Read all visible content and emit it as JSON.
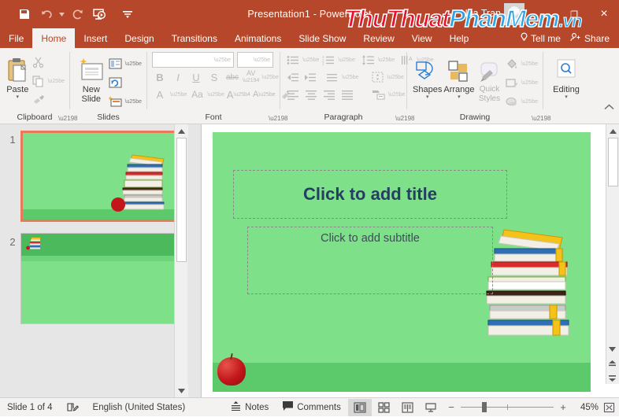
{
  "window": {
    "title": "Presentation1  -  PowerPoint",
    "user": "Nga Tran",
    "minimize": "–",
    "restore": "❐",
    "close": "×",
    "ribbon_display_icon": "ribbon-display-options-icon",
    "quick_access": [
      {
        "name": "save-icon",
        "label": "Save"
      },
      {
        "name": "undo-icon",
        "label": "Undo"
      },
      {
        "name": "redo-icon",
        "label": "Redo"
      },
      {
        "name": "start-presentation-icon",
        "label": "Start From Beginning"
      },
      {
        "name": "customize-quick-access-toolbar-icon",
        "label": "Customize Quick Access Toolbar"
      }
    ]
  },
  "watermark": {
    "part1": "ThuThuat",
    "part2": "PhanMem",
    "part3": ".vn"
  },
  "tabs": [
    {
      "label": "File",
      "active": false
    },
    {
      "label": "Home",
      "active": true
    },
    {
      "label": "Insert",
      "active": false
    },
    {
      "label": "Design",
      "active": false
    },
    {
      "label": "Transitions",
      "active": false
    },
    {
      "label": "Animations",
      "active": false
    },
    {
      "label": "Slide Show",
      "active": false
    },
    {
      "label": "Review",
      "active": false
    },
    {
      "label": "View",
      "active": false
    },
    {
      "label": "Help",
      "active": false
    }
  ],
  "tellme": {
    "label": "Tell me",
    "icon": "lightbulb-icon"
  },
  "share": {
    "label": "Share",
    "icon": "share-person-icon"
  },
  "ribbon": {
    "collapse_icon": "chevron-up-icon",
    "groups": [
      {
        "name": "clipboard",
        "label": "Clipboard",
        "paste": {
          "label": "Paste",
          "caret": "▾"
        },
        "cut": "cut-scissors-icon",
        "copy": "copy-icon",
        "format_painter": "format-painter-icon"
      },
      {
        "name": "slides",
        "label": "Slides",
        "new_slide": {
          "label": "New Slide",
          "caret": "▾"
        },
        "layout": "slide-layout-icon",
        "reset": "reset-slide-icon",
        "section": "section-icon"
      },
      {
        "name": "font",
        "label": "Font",
        "font_name_value": "",
        "font_size_value": "",
        "bold": "B",
        "italic": "I",
        "underline": "U",
        "shadow": "S",
        "strikethrough": "abc",
        "character_spacing": "AV",
        "font_color": "A",
        "change_case": "Aa",
        "increase_font": "A",
        "decrease_font": "A",
        "clear_formatting": "clear-formatting-icon"
      },
      {
        "name": "paragraph",
        "label": "Paragraph",
        "bullets": "bullets-icon",
        "numbering": "numbering-icon",
        "line_spacing": "line-spacing-icon",
        "text_direction": "text-direction-icon",
        "decrease_indent": "decrease-indent-icon",
        "increase_indent": "increase-indent-icon",
        "columns": "columns-icon",
        "align_text": "align-text-vertical-icon",
        "align_left": "align-left-icon",
        "align_center": "align-center-icon",
        "align_right": "align-right-icon",
        "justify": "justify-icon",
        "smartart": "convert-to-smartart-icon"
      },
      {
        "name": "drawing",
        "label": "Drawing",
        "shapes": {
          "label": "Shapes",
          "caret": "▾"
        },
        "arrange": {
          "label": "Arrange",
          "caret": "▾"
        },
        "quick_styles": {
          "label": "Quick Styles",
          "caret": "▾"
        },
        "shape_fill": "shape-fill-icon",
        "shape_outline": "shape-outline-icon",
        "shape_effects": "shape-effects-icon"
      },
      {
        "name": "editing",
        "label": "",
        "editing": {
          "label": "Editing",
          "caret": "▾",
          "icon": "magnifier-icon"
        }
      }
    ]
  },
  "thumbnails": {
    "scroll_up_icon": "scroll-up-arrow-icon",
    "scroll_down_icon": "scroll-down-arrow-icon",
    "slides": [
      {
        "number": "1",
        "selected": true,
        "layout": "title-slide-with-books"
      },
      {
        "number": "2",
        "selected": false,
        "layout": "title-and-content-with-header"
      }
    ]
  },
  "slide": {
    "title_placeholder": "Click to add title",
    "subtitle_placeholder": "Click to add subtitle",
    "background_color": "#7ee089",
    "floor_color": "#5cc96b",
    "title_color": "#243f60",
    "scroll_up_icon": "scroll-up-arrow-icon",
    "scroll_down_icon": "scroll-down-arrow-icon",
    "previous_slide_icon": "previous-slide-icon",
    "next_slide_icon": "next-slide-icon"
  },
  "status": {
    "slide_counter": "Slide 1 of 4",
    "spellcheck_icon": "spellcheck-icon",
    "language": "English (United States)",
    "notes": {
      "label": "Notes",
      "icon": "notes-icon"
    },
    "comments": {
      "label": "Comments",
      "icon": "comment-bubble-icon"
    },
    "views": [
      {
        "name": "normal-view-button",
        "icon": "normal-view-icon",
        "active": true
      },
      {
        "name": "slide-sorter-view-button",
        "icon": "slide-sorter-icon",
        "active": false
      },
      {
        "name": "reading-view-button",
        "icon": "reading-view-icon",
        "active": false
      },
      {
        "name": "slide-show-button",
        "icon": "slide-show-icon",
        "active": false
      }
    ],
    "zoom": {
      "minus": "−",
      "plus": "+",
      "percent": "45%",
      "fit_icon": "fit-slide-to-window-icon"
    }
  }
}
